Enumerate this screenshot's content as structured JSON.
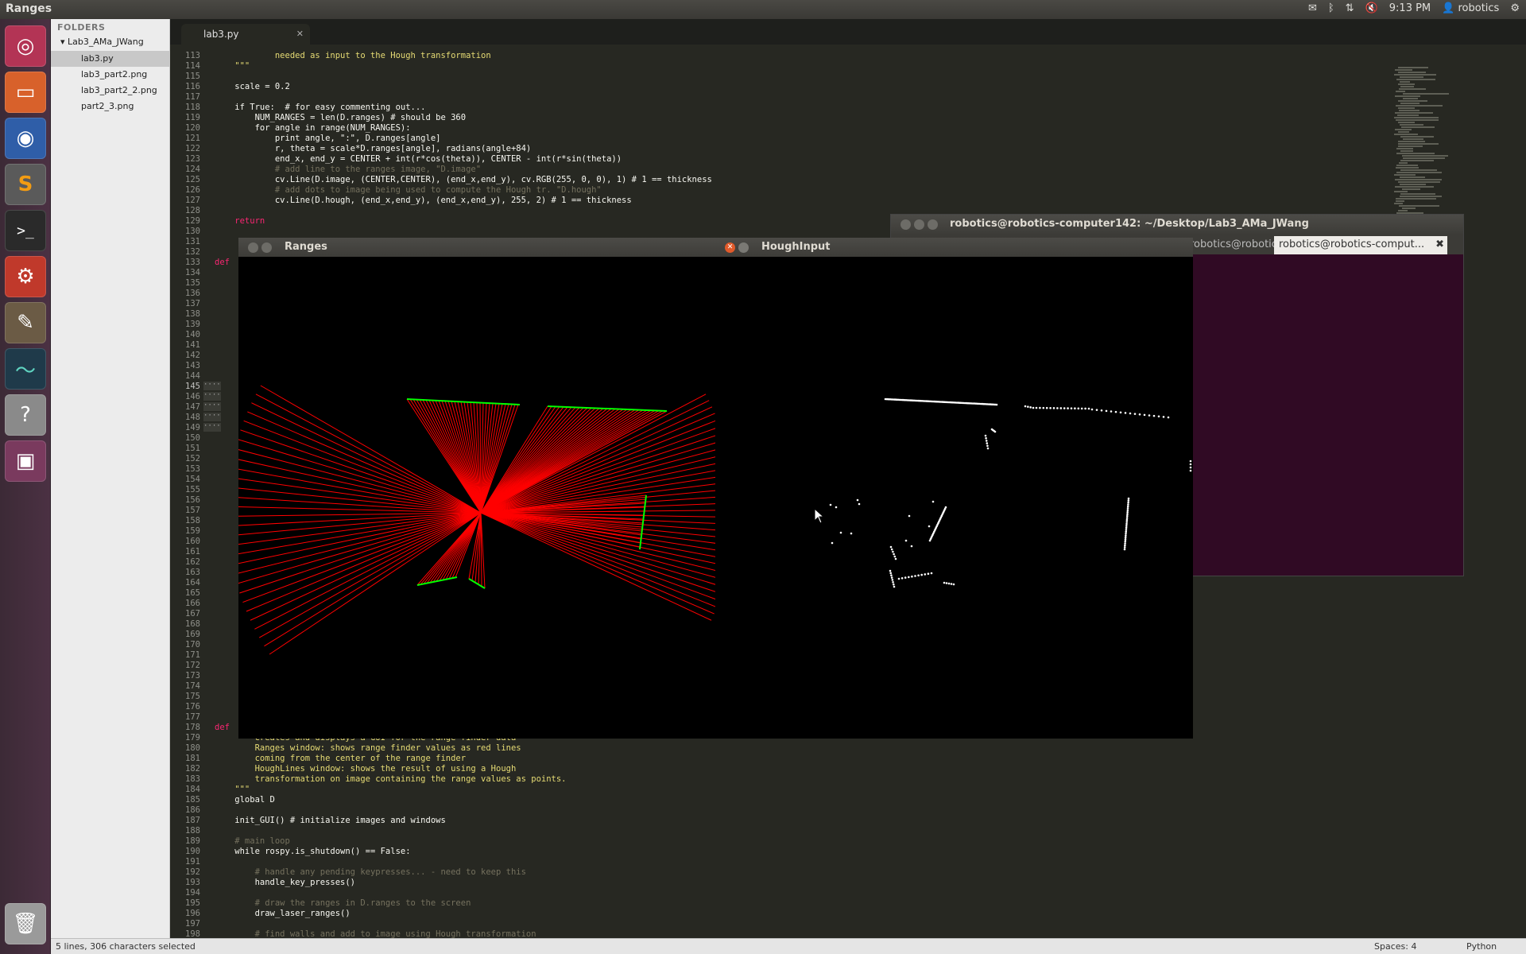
{
  "topbar": {
    "title": "Ranges",
    "time": "9:13 PM",
    "user": "robotics"
  },
  "launcher": {
    "items": [
      "ubuntu-dash",
      "files",
      "firefox",
      "sublime-text",
      "terminal",
      "system-settings",
      "gimp",
      "system-monitor",
      "help",
      "workspace-switcher",
      "trash"
    ]
  },
  "sidebar": {
    "header": "FOLDERS",
    "folder": "Lab3_AMa_JWang",
    "files": [
      "lab3.py",
      "lab3_part2.png",
      "lab3_part2_2.png",
      "part2_3.png"
    ],
    "selected": "lab3.py"
  },
  "editor": {
    "tab": "lab3.py",
    "lines_top_start": 113,
    "code_top": [
      {
        "n": 113,
        "t": "            needed as input to the Hough transformation",
        "c": "str"
      },
      {
        "n": 114,
        "t": "    \"\"\"",
        "c": "str"
      },
      {
        "n": 115,
        "t": "",
        "c": ""
      },
      {
        "n": 116,
        "t": "    scale = 0.2",
        "c": ""
      },
      {
        "n": 117,
        "t": "",
        "c": ""
      },
      {
        "n": 118,
        "t": "    if True:  # for easy commenting out...",
        "c": ""
      },
      {
        "n": 119,
        "t": "        NUM_RANGES = len(D.ranges) # should be 360",
        "c": ""
      },
      {
        "n": 120,
        "t": "        for angle in range(NUM_RANGES):",
        "c": ""
      },
      {
        "n": 121,
        "t": "            print angle, \":\", D.ranges[angle]",
        "c": ""
      },
      {
        "n": 122,
        "t": "            r, theta = scale*D.ranges[angle], radians(angle+84)",
        "c": ""
      },
      {
        "n": 123,
        "t": "            end_x, end_y = CENTER + int(r*cos(theta)), CENTER - int(r*sin(theta))",
        "c": ""
      },
      {
        "n": 124,
        "t": "            # add line to the ranges image, \"D.image\"",
        "c": "cm"
      },
      {
        "n": 125,
        "t": "            cv.Line(D.image, (CENTER,CENTER), (end_x,end_y), cv.RGB(255, 0, 0), 1) # 1 == thickness",
        "c": ""
      },
      {
        "n": 126,
        "t": "            # add dots to image being used to compute the Hough tr. \"D.hough\"",
        "c": "cm"
      },
      {
        "n": 127,
        "t": "            cv.Line(D.hough, (end_x,end_y), (end_x,end_y), 255, 2) # 1 == thickness",
        "c": ""
      },
      {
        "n": 128,
        "t": "",
        "c": ""
      },
      {
        "n": 129,
        "t": "    return",
        "c": "kw"
      }
    ],
    "def_line_133": "def",
    "def_line_178": "def",
    "code_bottom": [
      {
        "n": 179,
        "t": "        creates and displays a GUI for the range finder data",
        "c": "str"
      },
      {
        "n": 180,
        "t": "        Ranges window: shows range finder values as red lines",
        "c": "str"
      },
      {
        "n": 181,
        "t": "        coming from the center of the range finder",
        "c": "str"
      },
      {
        "n": 182,
        "t": "        HoughLines window: shows the result of using a Hough",
        "c": "str"
      },
      {
        "n": 183,
        "t": "        transformation on image containing the range values as points.",
        "c": "str"
      },
      {
        "n": 184,
        "t": "    \"\"\"",
        "c": "str"
      },
      {
        "n": 185,
        "t": "    global D",
        "c": ""
      },
      {
        "n": 186,
        "t": "",
        "c": ""
      },
      {
        "n": 187,
        "t": "    init_GUI() # initialize images and windows",
        "c": ""
      },
      {
        "n": 188,
        "t": "",
        "c": ""
      },
      {
        "n": 189,
        "t": "    # main loop",
        "c": "cm"
      },
      {
        "n": 190,
        "t": "    while rospy.is_shutdown() == False:",
        "c": ""
      },
      {
        "n": 191,
        "t": "",
        "c": ""
      },
      {
        "n": 192,
        "t": "        # handle any pending keypresses... - need to keep this",
        "c": "cm"
      },
      {
        "n": 193,
        "t": "        handle_key_presses()",
        "c": ""
      },
      {
        "n": 194,
        "t": "",
        "c": ""
      },
      {
        "n": 195,
        "t": "        # draw the ranges in D.ranges to the screen",
        "c": "cm"
      },
      {
        "n": 196,
        "t": "        draw_laser_ranges()",
        "c": ""
      },
      {
        "n": 197,
        "t": "",
        "c": ""
      },
      {
        "n": 198,
        "t": "        # find walls and add to image using Hough transformation",
        "c": "cm"
      }
    ]
  },
  "status": {
    "left": "5 lines, 306 characters selected",
    "spaces": "Spaces: 4",
    "syntax": "Python"
  },
  "ranges_window": {
    "title": "Ranges"
  },
  "hough_window": {
    "title": "HoughInput"
  },
  "terminal": {
    "title": "robotics@robotics-computer142: ~/Desktop/Lab3_AMa_JWang",
    "tab1": "robotics@robotics-comput...",
    "tab2": "robotics@robotics-comput..."
  },
  "colors": {
    "editor_bg": "#272822",
    "range_line": "#ff0000",
    "range_end": "#00ff00",
    "terminal_bg": "#300a24"
  }
}
